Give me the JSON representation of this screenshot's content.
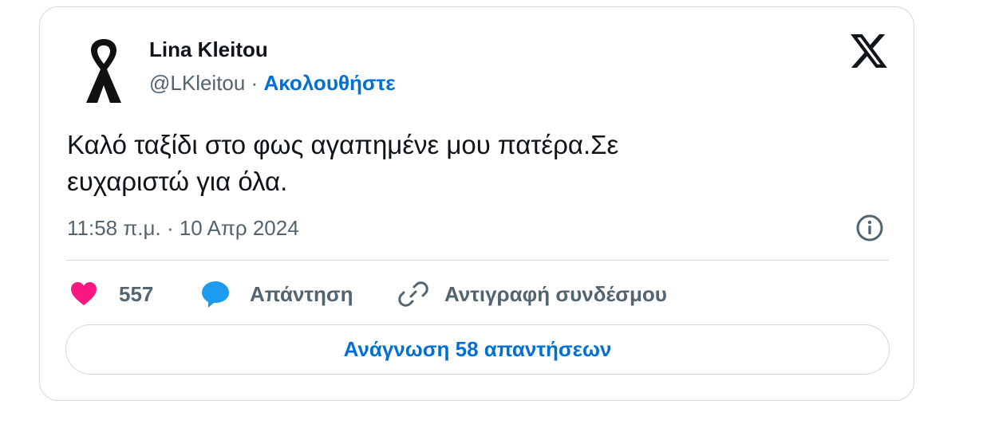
{
  "author": {
    "name": "Lina Kleitou",
    "handle": "@LKleitou",
    "separator": "·",
    "follow_label": "Ακολουθήστε"
  },
  "tweet": {
    "text_line1": "Καλό ταξίδι στο φως αγαπημένε μου πατέρα.Σε",
    "text_line2": "ευχαριστώ για όλα.",
    "timestamp": "11:58 π.μ. · 10 Απρ 2024"
  },
  "actions": {
    "like_count": "557",
    "reply_label": "Απάντηση",
    "copy_link_label": "Αντιγραφή συνδέσμου"
  },
  "footer": {
    "read_replies_label": "Ανάγνωση 58 απαντήσεων"
  },
  "icons": {
    "avatar": "black-ribbon-icon",
    "brand": "x-logo-icon",
    "info": "info-icon",
    "like": "heart-icon",
    "reply": "speech-bubble-icon",
    "copy": "link-icon"
  },
  "colors": {
    "text": "#0f1419",
    "secondary": "#536471",
    "link": "#006fd6",
    "heart": "#f91880",
    "reply": "#1d9bf0",
    "border": "#cfd9de"
  }
}
